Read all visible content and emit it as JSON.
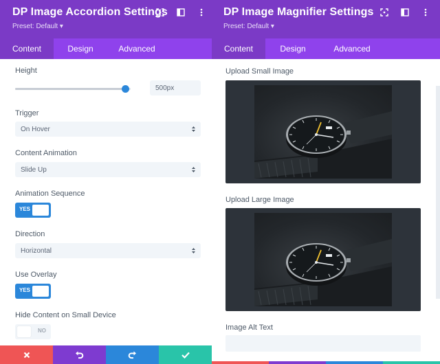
{
  "colors": {
    "header_bg": "#7b3ac6",
    "tabbar_bg": "#8f42ec",
    "accent_blue": "#2b87da",
    "discard_red": "#ef5555",
    "undo_purple": "#7e3bd0",
    "redo_blue": "#2b87da",
    "save_green": "#29c4a9"
  },
  "left_panel": {
    "title": "DP Image Accordion Settings",
    "preset": "Preset: Default ▾",
    "header_icons": [
      "expand-icon",
      "columns-icon",
      "more-icon"
    ],
    "tabs": [
      {
        "label": "Content",
        "active": true
      },
      {
        "label": "Design",
        "active": false
      },
      {
        "label": "Advanced",
        "active": false
      }
    ],
    "height": {
      "label": "Height",
      "value": "500px",
      "slider_position": 0.95
    },
    "trigger": {
      "label": "Trigger",
      "value": "On Hover"
    },
    "content_animation": {
      "label": "Content Animation",
      "value": "Slide Up"
    },
    "animation_sequence": {
      "label": "Animation Sequence",
      "toggle_text": "YES",
      "on": true
    },
    "direction": {
      "label": "Direction",
      "value": "Horizontal"
    },
    "use_overlay": {
      "label": "Use Overlay",
      "toggle_text": "YES",
      "on": true
    },
    "hide_content": {
      "label": "Hide Content on Small Device",
      "toggle_text": "NO",
      "on": false
    },
    "actions": [
      "close-icon",
      "undo-icon",
      "redo-icon",
      "check-icon"
    ]
  },
  "right_panel": {
    "title": "DP Image Magnifier Settings",
    "preset": "Preset: Default ▾",
    "header_icons": [
      "expand-icon",
      "columns-icon",
      "more-icon"
    ],
    "tabs": [
      {
        "label": "Content",
        "active": true
      },
      {
        "label": "Design",
        "active": false
      },
      {
        "label": "Advanced",
        "active": false
      }
    ],
    "upload_small": {
      "label": "Upload Small Image",
      "image": "wristwatch-photo"
    },
    "upload_large": {
      "label": "Upload Large Image",
      "image": "wristwatch-photo"
    },
    "alt_text": {
      "label": "Image Alt Text",
      "value": ""
    }
  }
}
